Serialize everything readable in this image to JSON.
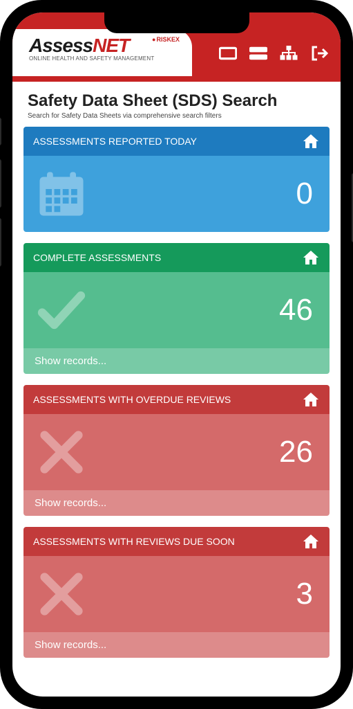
{
  "logo": {
    "line1_a": "Assess",
    "line1_b": "NET",
    "tag": "RISKEX",
    "sub": "ONLINE HEALTH AND SAFETY MANAGEMENT"
  },
  "page": {
    "title": "Safety Data Sheet (SDS) Search",
    "subtitle": "Search for Safety Data Sheets via comprehensive search filters"
  },
  "cards": [
    {
      "title": "ASSESSMENTS REPORTED TODAY",
      "value": "0",
      "footer": "",
      "icon": "calendar",
      "theme": "blue"
    },
    {
      "title": "COMPLETE ASSESSMENTS",
      "value": "46",
      "footer": "Show records...",
      "icon": "check",
      "theme": "green"
    },
    {
      "title": "ASSESSMENTS WITH OVERDUE REVIEWS",
      "value": "26",
      "footer": "Show records...",
      "icon": "cross",
      "theme": "red"
    },
    {
      "title": "ASSESSMENTS WITH REVIEWS DUE SOON",
      "value": "3",
      "footer": "Show records...",
      "icon": "cross",
      "theme": "red2"
    }
  ]
}
